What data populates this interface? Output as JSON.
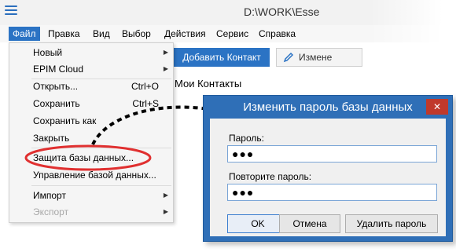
{
  "window": {
    "title": "D:\\WORK\\Esse",
    "app_icon": "hamburger-icon"
  },
  "menubar": {
    "items": [
      "Файл",
      "Правка",
      "Вид",
      "Выбор",
      "Действия",
      "Сервис",
      "Справка"
    ],
    "active": "Файл"
  },
  "toolbar": {
    "add_contact": "Добавить Контакт",
    "edit": "Измене",
    "edit_icon": "pencil-icon"
  },
  "main": {
    "contacts_title": "Мои Контакты"
  },
  "file_menu": {
    "items": [
      {
        "label": "Новый",
        "submenu": true
      },
      {
        "label": "EPIM Cloud",
        "submenu": true
      },
      {
        "label": "Открыть...",
        "shortcut": "Ctrl+O"
      },
      {
        "label": "Сохранить",
        "shortcut": "Ctrl+S"
      },
      {
        "label": "Сохранить как"
      },
      {
        "label": "Закрыть"
      },
      {
        "label": "Защита базы данных...",
        "highlighted": true
      },
      {
        "label": "Управление базой данных..."
      },
      {
        "label": "Импорт",
        "submenu": true
      },
      {
        "label": "Экспорт",
        "submenu": true,
        "disabled": true
      }
    ]
  },
  "dialog": {
    "title": "Изменить пароль базы данных",
    "close_icon": "close-icon",
    "password_label": "Пароль:",
    "password_value": "●●●",
    "repeat_label": "Повторите пароль:",
    "repeat_value": "●●●",
    "buttons": {
      "ok": "OK",
      "cancel": "Отмена",
      "remove": "Удалить пароль"
    }
  },
  "colors": {
    "accent": "#2b73c4",
    "dialog_frame": "#2f6fb7",
    "close": "#c0392b",
    "highlight": "#e03030"
  }
}
